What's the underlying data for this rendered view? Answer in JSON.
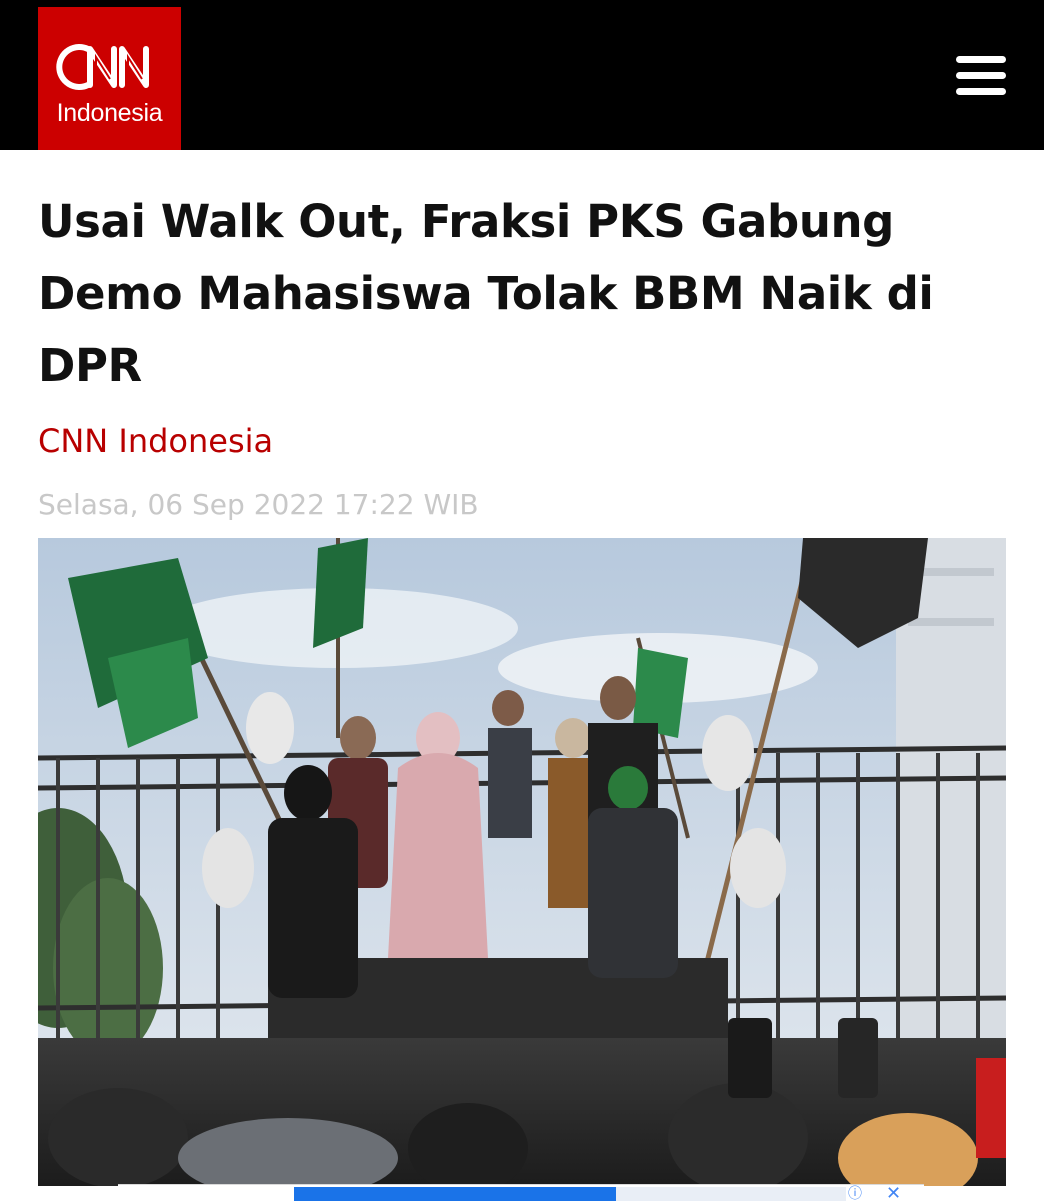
{
  "header": {
    "logo_brand": "CNN",
    "logo_subtitle": "Indonesia",
    "menu_icon": "hamburger-menu-icon"
  },
  "article": {
    "title": "Usai Walk Out, Fraksi PKS Gabung Demo Mahasiswa Tolak BBM Naik di DPR",
    "source": "CNN Indonesia",
    "date": "Selasa, 06 Sep 2022 17:22 WIB"
  },
  "ad": {
    "info_icon": "ad-info-icon",
    "close_icon": "close-icon",
    "info_glyph": "ⓘ",
    "close_glyph": "✕"
  },
  "colors": {
    "header_bg": "#000000",
    "brand_red": "#cc0000",
    "source_red": "#b80000",
    "date_gray": "#c8c8c8"
  }
}
